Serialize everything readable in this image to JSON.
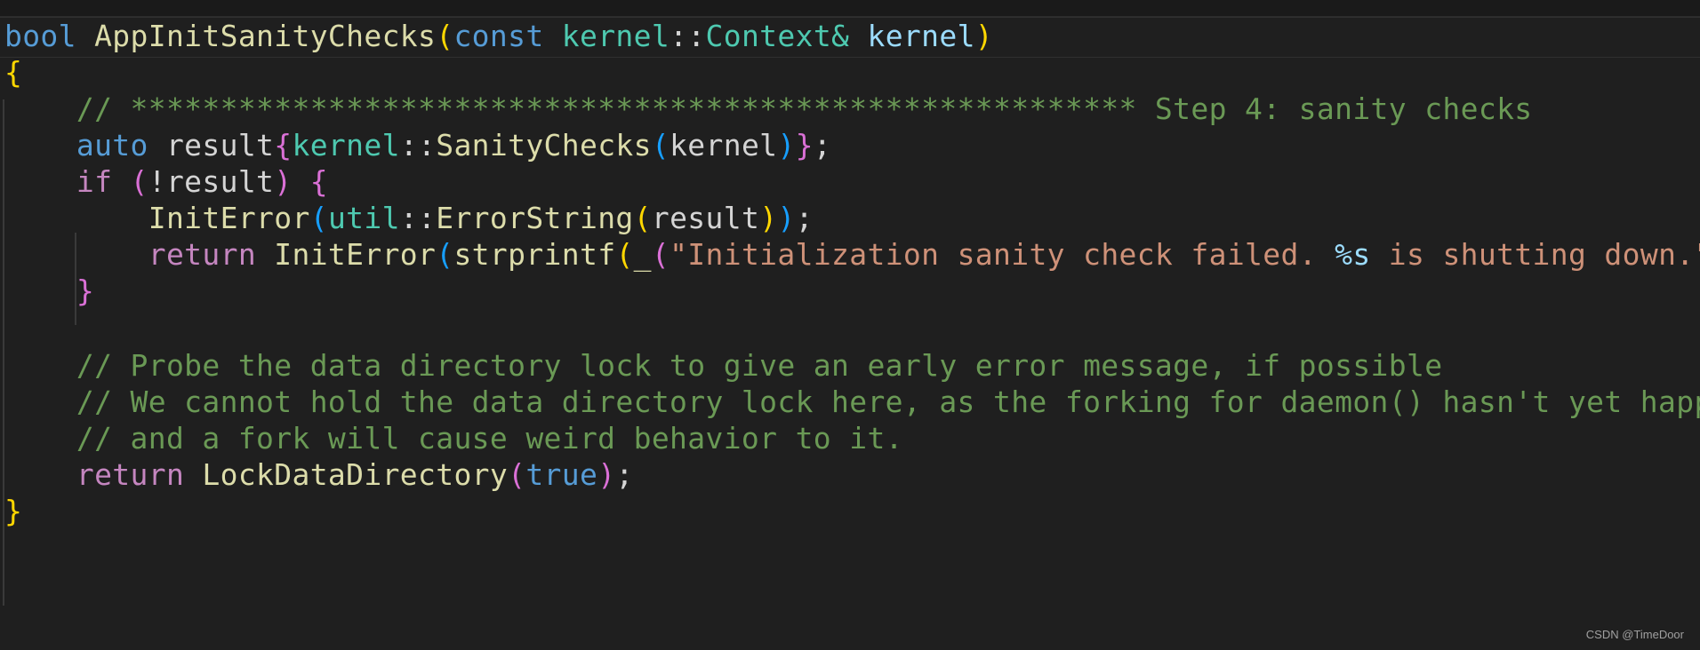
{
  "code": {
    "line1": {
      "kw_bool": "bool",
      "fn_name": "AppInitSanityChecks",
      "paren_open": "(",
      "kw_const": "const",
      "ns": "kernel",
      "scope": "::",
      "type": "Context&",
      "param": "kernel",
      "paren_close": ")"
    },
    "line2": {
      "brace": "{"
    },
    "line3": {
      "comment": "// ******************************************************** Step 4: sanity checks"
    },
    "line4": {
      "kw_auto": "auto",
      "var": "result",
      "brace_open": "{",
      "ns": "kernel",
      "scope": "::",
      "fn": "SanityChecks",
      "paren_open": "(",
      "arg": "kernel",
      "paren_close": ")",
      "brace_close": "}",
      "semi": ";"
    },
    "line5": {
      "kw_if": "if",
      "paren_open": "(",
      "expr": "!result",
      "paren_close": ")",
      "brace": "{"
    },
    "line6": {
      "fn": "InitError",
      "paren_open": "(",
      "ns": "util",
      "scope": "::",
      "fn2": "ErrorString",
      "paren2_open": "(",
      "arg": "result",
      "paren2_close": ")",
      "paren_close": ")",
      "semi": ";"
    },
    "line7": {
      "kw_return": "return",
      "fn": "InitError",
      "paren_open": "(",
      "fn2": "strprintf",
      "paren2_open": "(",
      "fn3": "_",
      "paren3_open": "(",
      "str_start": "\"Initialization sanity check failed. ",
      "fmt": "%s",
      "str_end": " is shutting down.\""
    },
    "line8": {
      "brace": "}"
    },
    "line10": {
      "comment": "// Probe the data directory lock to give an early error message, if possible"
    },
    "line11": {
      "comment": "// We cannot hold the data directory lock here, as the forking for daemon() hasn't yet happ"
    },
    "line12": {
      "comment": "// and a fork will cause weird behavior to it."
    },
    "line13": {
      "kw_return": "return",
      "fn": "LockDataDirectory",
      "paren_open": "(",
      "arg": "true",
      "paren_close": ")",
      "semi": ";"
    },
    "line14": {
      "brace": "}"
    }
  },
  "watermark": "CSDN @TimeDoor"
}
